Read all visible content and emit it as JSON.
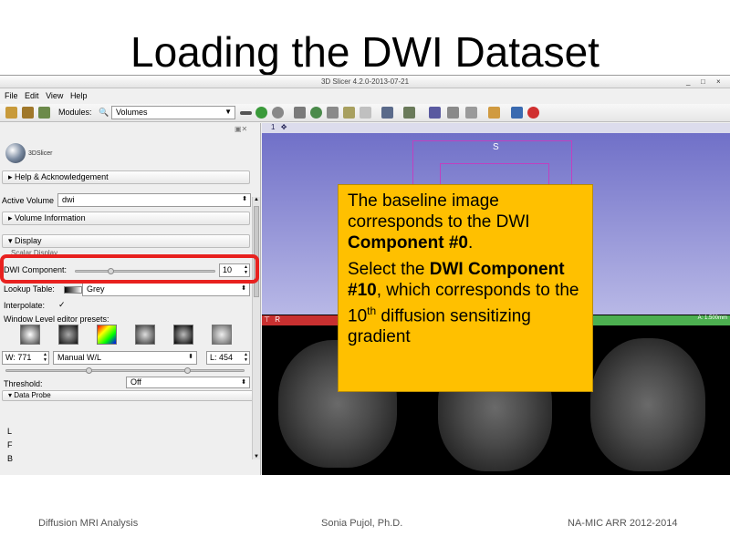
{
  "slide": {
    "title": "Loading the DWI Dataset",
    "footer_left": "Diffusion MRI Analysis",
    "footer_center": "Sonia Pujol, Ph.D.",
    "footer_right": "NA-MIC ARR 2012-2014"
  },
  "window": {
    "title": "3D Slicer 4.2.0-2013-07-21",
    "controls": [
      "_",
      "□",
      "×"
    ]
  },
  "menu": [
    "File",
    "Edit",
    "View",
    "Help"
  ],
  "toolbar": {
    "modules_label": "Modules:",
    "module_selected": "Volumes"
  },
  "panel": {
    "logo_text": "3DSlicer",
    "help_section": "Help & Acknowledgement",
    "active_volume_label": "Active Volume",
    "active_volume_value": "dwi",
    "volume_info_section": "Volume Information",
    "display_section": "Display",
    "scalar_display_label": "Scalar Display",
    "dwi_component_label": "DWI Component:",
    "dwi_component_value": "10",
    "dwi_component_fraction": 0.25,
    "lookup_table_label": "Lookup Table:",
    "lookup_table_value": "Grey",
    "interpolate_label": "Interpolate:",
    "interpolate_check": "✓",
    "presets_label": "Window Level editor presets:",
    "window_value": "W: 771",
    "window_mode": "Manual W/L",
    "level_value": "L: 454",
    "threshold_label": "Threshold:",
    "threshold_value": "Off",
    "data_probe_section": "Data Probe",
    "probe_letters": [
      "L",
      "F",
      "B"
    ]
  },
  "views": {
    "view3d_label": "1",
    "orientation_label": "S",
    "red_label": "R",
    "green_value": "A: 1.500mm"
  },
  "callout": {
    "line1": "The baseline image corresponds to the DWI ",
    "line1_bold": "Component #0",
    "line1_end": ".",
    "line2": "Select the ",
    "line2_bold": "DWI Component #10",
    "line2_mid": ", which corresponds to the 10",
    "line2_sup": "th",
    "line2_end": " diffusion sensitizing gradient"
  },
  "colors": {
    "highlight": "#e8211f",
    "callout_bg": "#ffc000",
    "view3d_bg": "#9090d8",
    "red_view": "#c83030",
    "green_view": "#4caf50"
  }
}
